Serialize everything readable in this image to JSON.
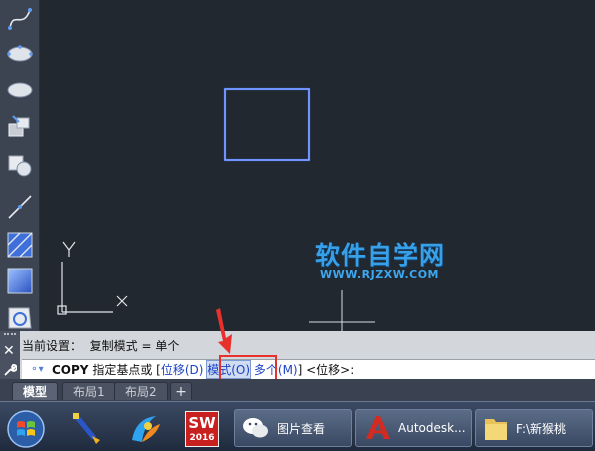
{
  "toolbar": {
    "tools": [
      {
        "name": "spline-icon"
      },
      {
        "name": "ellipse-icon"
      },
      {
        "name": "ellipse-arc-icon"
      },
      {
        "name": "insert-block-icon"
      },
      {
        "name": "create-block-icon"
      },
      {
        "name": "line-icon"
      },
      {
        "name": "hatch-icon"
      },
      {
        "name": "gradient-icon"
      },
      {
        "name": "region-icon"
      }
    ]
  },
  "canvas": {
    "ucs_y_label": "Y",
    "ucs_x_label": "X",
    "shape_color": "#4a78ff"
  },
  "watermark": {
    "main": "软件自学网",
    "sub": "WWW.RJZXW.COM"
  },
  "command": {
    "history": "当前设置：  复制模式 = 单个",
    "cmd_name": "COPY",
    "prompt": " 指定基点或 [",
    "opt1": "位移(D)",
    "opt2": "模式(O)",
    "opt3": "多个(M)",
    "tail": "] <位移>:",
    "close_label": "✕"
  },
  "tabs": {
    "items": [
      "模型",
      "布局1",
      "布局2"
    ],
    "add_label": "+"
  },
  "taskbar": {
    "apps": [
      {
        "name": "start-button"
      },
      {
        "name": "app-icon-1"
      },
      {
        "name": "app-icon-2"
      },
      {
        "name": "solidworks-2016-icon",
        "label": "SW",
        "year": "2016"
      }
    ],
    "windows": [
      {
        "label": "图片查看"
      },
      {
        "label": "Autodesk..."
      },
      {
        "label": "F:\\新猴桃"
      }
    ]
  },
  "colors": {
    "annotation_red": "#e8302c",
    "option_blue": "#1d43c4"
  }
}
